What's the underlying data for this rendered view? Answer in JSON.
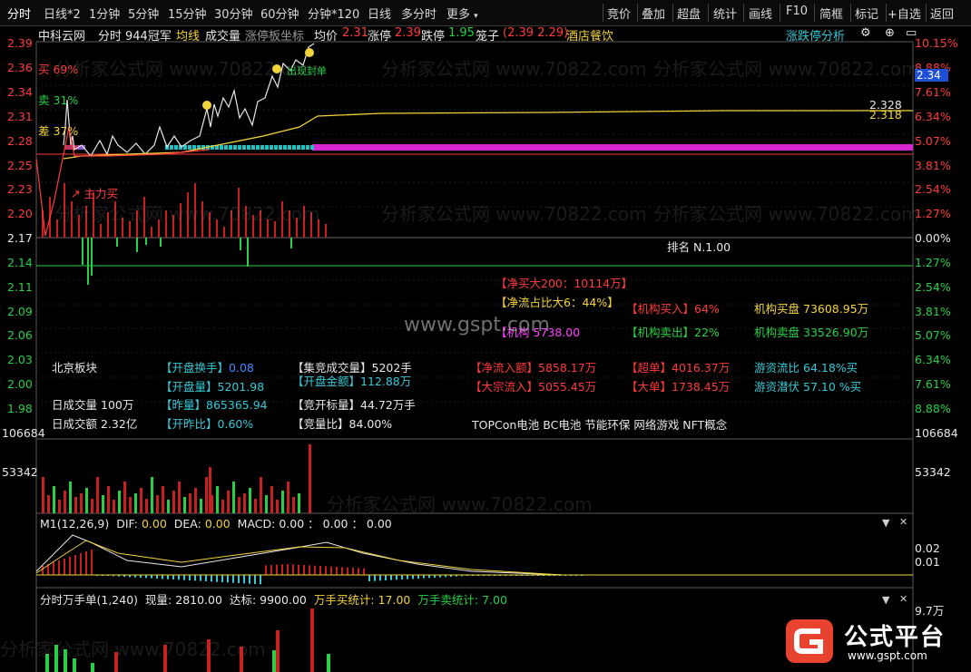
{
  "toolbar": {
    "tabs": [
      {
        "label": "分时",
        "active": true
      },
      {
        "label": "日线*2"
      },
      {
        "label": "1分钟"
      },
      {
        "label": "5分钟"
      },
      {
        "label": "15分钟"
      },
      {
        "label": "30分钟"
      },
      {
        "label": "60分钟"
      },
      {
        "label": "分钟*120"
      },
      {
        "label": "日线"
      },
      {
        "label": "多分时"
      },
      {
        "label": "更多"
      }
    ],
    "right_buttons": [
      "竞价",
      "叠加",
      "超盘",
      "统计",
      "画线",
      "F10",
      "简框",
      "标记",
      "+自选",
      "返回"
    ]
  },
  "info": {
    "stock_name": "中科云网",
    "mode": "分时",
    "rank_text": "944冠军",
    "avg_line": "均线",
    "volume": "成交量",
    "limit_coord": "涨停板坐标",
    "avg_price_label": "均价",
    "avg_price": "2.31",
    "limit_up_label": "涨停",
    "limit_up": "2.39",
    "limit_down_label": "跌停",
    "limit_down": "1.95",
    "cage_label": "笼子",
    "cage_value": "(2.39 2.29)",
    "industry": "酒店餐饮",
    "analysis_link": "涨跌停分析"
  },
  "price_axis": {
    "left": [
      "2.39",
      "2.36",
      "2.34",
      "2.31",
      "2.28",
      "2.25",
      "2.23",
      "2.20",
      "2.17",
      "2.14",
      "2.11",
      "2.09",
      "2.06",
      "2.03",
      "2.00",
      "1.98"
    ],
    "right": [
      "10.15%",
      "8.88%",
      "7.61%",
      "6.34%",
      "5.07%",
      "3.81%",
      "2.54%",
      "1.27%",
      "0.00%",
      "1.27%",
      "2.54%",
      "3.81%",
      "5.07%",
      "6.34%",
      "7.61%",
      "8.88%"
    ],
    "current_price_tag": "2.34",
    "vol_left": [
      "106684",
      "53342"
    ],
    "vol_right": [
      "106684",
      "53342"
    ]
  },
  "chart_labels": {
    "buy_pct": "买 69%",
    "sell_pct": "卖 31%",
    "diff_pct": "差 37%",
    "main_buy": "主力买",
    "cross": "出现封单",
    "avg_a": "2.328",
    "avg_b": "2.318",
    "rank": "排名 N.1.00"
  },
  "stats": {
    "block": "北京板块",
    "open_turnover_label": "【开盘换手】",
    "open_turnover": "0.08",
    "open_vol_label": "【开盘量】",
    "open_vol": "5201.98",
    "prev_vol_label": "【昨量】",
    "prev_vol": "865365.94",
    "open_ratio_label": "【开昨比】",
    "open_ratio": "0.60%",
    "day_vol_label": "日成交量",
    "day_vol": "100万",
    "day_amt_label": "日成交额",
    "day_amt": "2.32亿",
    "auction_vol_label": "【集竞成交量】",
    "auction_vol": "5202手",
    "open_amt_label": "【开盘金额】",
    "open_amt": "112.88万",
    "bid_label": "【竞开标量】",
    "bid": "44.72万手",
    "bid_ratio_label": "【竞量比】",
    "bid_ratio": "84.00%",
    "net_buy_label": "【净买大200：",
    "net_buy": "10114万】",
    "net_flow_label": "【净流占比大6：",
    "net_flow": "44%】",
    "hidden_label": "【机构",
    "hidden_val": "5738.00",
    "inst_buy_label": "【机构买入】",
    "inst_buy": "64%",
    "inst_sell_label": "【机构卖出】",
    "inst_sell": "22%",
    "inst_buy_amt_label": "机构买盘",
    "inst_buy_amt": "73608.95万",
    "inst_sell_amt_label": "机构卖盘",
    "inst_sell_amt": "33526.90万",
    "net_in_label": "【净流入额】",
    "net_in": "5858.17万",
    "big_in_label": "【大宗流入】",
    "big_in": "5055.45万",
    "super_label": "【超单】",
    "super": "4016.37万",
    "large_label": "【大单】",
    "large": "1738.45万",
    "hot_flow_label": "游资流比",
    "hot_flow": "64.18%买",
    "hot_pot_label": "游资潜伏",
    "hot_pot": "57.10 %买",
    "concepts": "TOPCon电池 BC电池 节能环保 网络游戏 NFT概念"
  },
  "macd": {
    "title": "M1(12,26,9)",
    "dif_label": "DIF:",
    "dif": "0.00",
    "dea_label": "DEA:",
    "dea": "0.00",
    "macd_label": "MACD:",
    "macd": "0.00 ： 0.00 ： 0.00",
    "axis": [
      "0.02",
      "0.01"
    ]
  },
  "bottom_panel": {
    "title": "分时万手单(1,240)",
    "now_label": "现量:",
    "now": "2810.00",
    "reach_label": "达标:",
    "reach": "9900.00",
    "buy_stat_label": "万手买统计:",
    "buy_stat": "17.00",
    "sell_stat_label": "万手卖统计:",
    "sell_stat": "7.00",
    "axis_top": "9.7万"
  },
  "watermarks": {
    "site": "www.gspt.com",
    "logo_text": "公式平台",
    "logo_url": "www.gspt.com",
    "wm_text": "分析家公式网 www.70822.com"
  },
  "colors": {
    "up": "#ff3b3b",
    "down": "#27d046",
    "avg": "#f2d33b",
    "bg": "#000000"
  }
}
